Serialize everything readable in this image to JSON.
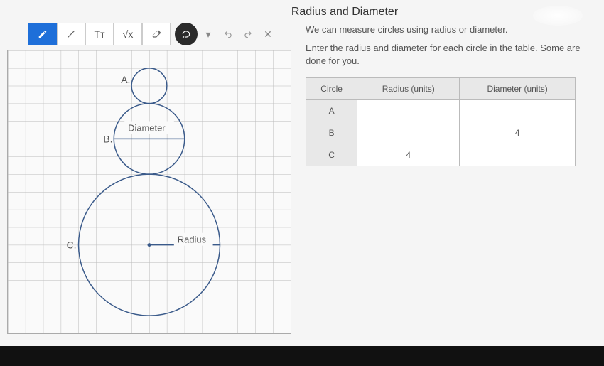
{
  "title": "Radius and Diameter",
  "toolbar": {
    "tools": [
      "pen",
      "line",
      "text",
      "equation",
      "eraser",
      "lasso"
    ],
    "text_label": "Tᴛ",
    "eq_label": "√x"
  },
  "intro": "We can measure circles using radius or diameter.",
  "instruction": "Enter the radius and diameter for each circle in the table. Some are done for you.",
  "table": {
    "headers": [
      "Circle",
      "Radius (units)",
      "Diameter (units)"
    ],
    "rows": [
      {
        "circle": "A",
        "radius": "",
        "diameter": ""
      },
      {
        "circle": "B",
        "radius": "",
        "diameter": "4"
      },
      {
        "circle": "C",
        "radius": "4",
        "diameter": ""
      }
    ]
  },
  "diagram": {
    "labels": {
      "a": "A.",
      "b": "B.",
      "c": "C.",
      "diameter": "Diameter",
      "radius": "Radius"
    }
  },
  "chart_data": {
    "type": "diagram",
    "description": "Three stacked circles on a unit grid illustrating radius and diameter",
    "grid_unit": 1,
    "circles": [
      {
        "name": "A",
        "center_grid": [
          8,
          2
        ],
        "radius_units": 1
      },
      {
        "name": "B",
        "center_grid": [
          8,
          5
        ],
        "radius_units": 2,
        "annotation": "Diameter"
      },
      {
        "name": "C",
        "center_grid": [
          8,
          11
        ],
        "radius_units": 4,
        "annotation": "Radius"
      }
    ]
  }
}
